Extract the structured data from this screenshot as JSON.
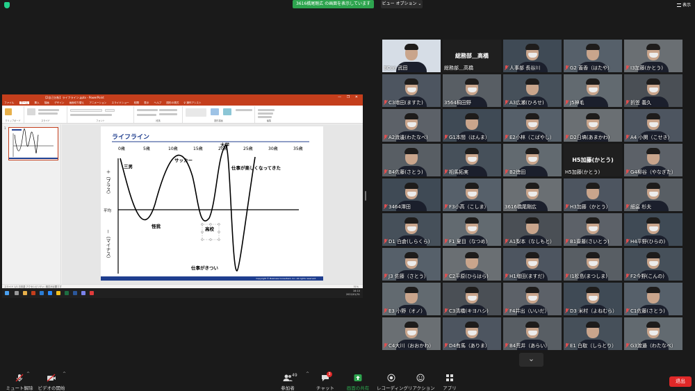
{
  "topbar": {
    "share_banner": "3616橋尾剛広 の画面を表示しています",
    "view_options": "ビュー オプション ⌄",
    "view_button": "表示"
  },
  "powerpoint": {
    "title": "【2自己分析】ライフライン.pptx - PowerPoint",
    "tabs": [
      "ファイル",
      "ホーム",
      "挿入",
      "描画",
      "デザイン",
      "画面切り替え",
      "アニメーション",
      "スライドショー",
      "校閲",
      "表示",
      "ヘルプ",
      "図形の書式",
      "♀ 操作アシスト"
    ],
    "ribbon_groups": [
      "クリップボード",
      "スライド",
      "フォント",
      "段落",
      "図形描画",
      "編集"
    ],
    "slide_number": "1",
    "status": "スライド 1/1   日本語   アクセシビリティ: 検討が必要です",
    "zoom": "51%",
    "clock_time": "16:10",
    "clock_date": "2022/01/31"
  },
  "slide": {
    "title": "ライフライン",
    "ages": [
      "0歳",
      "5歳",
      "10歳",
      "15歳",
      "20歳",
      "25歳",
      "30歳",
      "35歳"
    ],
    "axis_plus": "＋（プラス）",
    "axis_average": "平均",
    "axis_minus": "－（マイナス）",
    "annotations": {
      "sanan": "三男",
      "soccer": "サッカー",
      "daigaku": "大学",
      "fun": "仕事が楽しくなってきた",
      "kega": "怪我",
      "koukou": "高校",
      "kitsui": "仕事がきつい"
    },
    "footer": "Copyright © Business Consultant, Inc. All rights reserved."
  },
  "participants": [
    {
      "name": "BCon 武田",
      "muted": false,
      "active": true
    },
    {
      "name": "総務部＿高橋",
      "muted": false,
      "top_label": "総務部＿高橋"
    },
    {
      "name": "人事部 長谷川",
      "muted": true
    },
    {
      "name": "G2 蓋香（はたや）",
      "muted": true
    },
    {
      "name": "I3加藤(かとう)",
      "muted": true
    },
    {
      "name": "C3増田(ますた)",
      "muted": true
    },
    {
      "name": "3564桐田野",
      "muted": false
    },
    {
      "name": "A3広瀬(ひろせ)",
      "muted": true
    },
    {
      "name": "J5神毛",
      "muted": true
    },
    {
      "name": "折笠 義久",
      "muted": true
    },
    {
      "name": "A2渡邊(わたなべ)",
      "muted": true
    },
    {
      "name": "G1本間（ほんま）",
      "muted": true
    },
    {
      "name": "E2小林（こばやし）",
      "muted": true
    },
    {
      "name": "D2日塙(あまかわ)",
      "muted": true
    },
    {
      "name": "A4 小関（こせき）",
      "muted": true
    },
    {
      "name": "B4佐藤(さとう)",
      "muted": true
    },
    {
      "name": "相馬拓実",
      "muted": true
    },
    {
      "name": "B2徳田",
      "muted": true
    },
    {
      "name": "H5加藤(かとう)",
      "muted": false,
      "top_label": "H5加藤(かとう)"
    },
    {
      "name": "G4柳谷（やなぎた）",
      "muted": true
    },
    {
      "name": "3464澤田",
      "muted": true
    },
    {
      "name": "F3小高（こしま）",
      "muted": true
    },
    {
      "name": "3616橋尾剛広",
      "muted": false
    },
    {
      "name": "H3加藤（かとう）",
      "muted": true
    },
    {
      "name": "細畠 杉夫",
      "muted": true
    },
    {
      "name": "D1 白倉(しらくら)",
      "muted": true
    },
    {
      "name": "F1 夏目（なつめ）",
      "muted": true
    },
    {
      "name": "A1梨本（なしもと）",
      "muted": true
    },
    {
      "name": "B1齋藤(さいとう)",
      "muted": true
    },
    {
      "name": "H4平野(ひらの)",
      "muted": true
    },
    {
      "name": "J3 佐藤（さとう）",
      "muted": true
    },
    {
      "name": "C2平原(ひらはら)",
      "muted": true
    },
    {
      "name": "H1増田(ますだ)",
      "muted": true
    },
    {
      "name": "I1松島(まつしま)",
      "muted": true
    },
    {
      "name": "F2今野(こんの)",
      "muted": true
    },
    {
      "name": "E3 小野（オノ）",
      "muted": true
    },
    {
      "name": "C3清橋(キヨハシ)",
      "muted": true
    },
    {
      "name": "F4井出（いいだ）",
      "muted": true
    },
    {
      "name": "D3 米村（よねむら）",
      "muted": true
    },
    {
      "name": "C1佐藤(さとう)",
      "muted": true
    },
    {
      "name": "C4大川（おおかわ）",
      "muted": true
    },
    {
      "name": "D4有馬（ありま）",
      "muted": true
    },
    {
      "name": "B4荒井（あらい）",
      "muted": true
    },
    {
      "name": "E1 白取（しらとり）",
      "muted": true
    },
    {
      "name": "G3渡邉（わたなべ）",
      "muted": true
    }
  ],
  "toolbar": {
    "mute": "ミュート解除",
    "video": "ビデオの開始",
    "participants": "参加者",
    "participants_count": "49",
    "chat": "チャット",
    "chat_badge": "3",
    "share": "画面の共有",
    "record": "レコーディング",
    "reactions": "リアクション",
    "apps": "アプリ",
    "end": "退出"
  },
  "colors": {
    "accent_green": "#2da44e",
    "active_speaker": "#c3e63a",
    "end_red": "#e02828",
    "muted_red": "#e05050",
    "ppt_orange": "#c43e1c",
    "slide_blue": "#1f3e8e"
  }
}
